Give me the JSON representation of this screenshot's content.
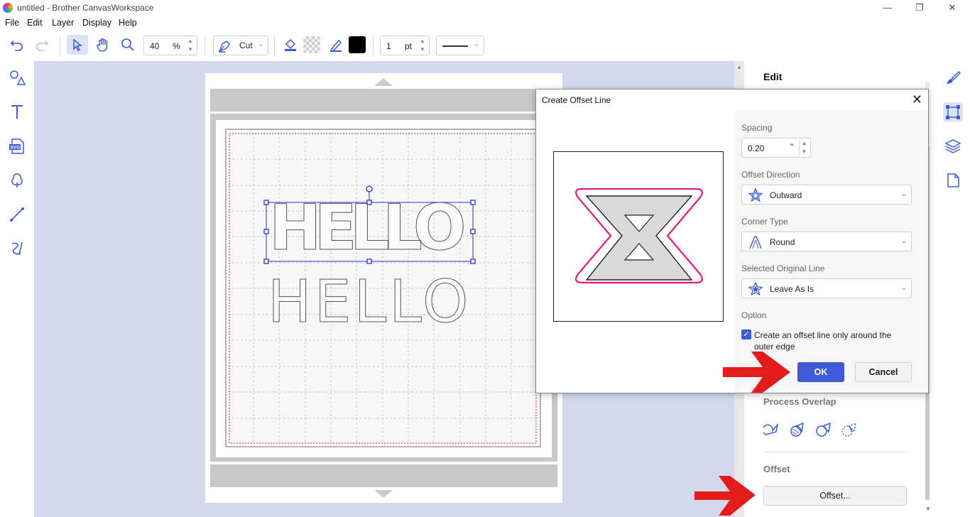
{
  "window": {
    "title": "untitled - Brother CanvasWorkspace"
  },
  "menu": [
    "File",
    "Edit",
    "Layer",
    "Display",
    "Help"
  ],
  "toolbar": {
    "zoom_value": "40",
    "zoom_unit": "%",
    "mode_label": "Cut",
    "line_width_value": "1",
    "line_width_unit": "pt",
    "line_color": "#000000"
  },
  "canvas": {
    "text_top": "HELLO",
    "text_bottom": "HELLO"
  },
  "right_panel": {
    "title": "Edit",
    "process_overlap_label": "Process Overlap",
    "offset_label": "Offset",
    "offset_button": "Offset..."
  },
  "dialog": {
    "title": "Create Offset Line",
    "spacing_label": "Spacing",
    "spacing_value": "0.20",
    "spacing_unit": "\"",
    "offset_direction_label": "Offset Direction",
    "offset_direction_value": "Outward",
    "corner_type_label": "Corner Type",
    "corner_type_value": "Round",
    "selected_original_label": "Selected Original Line",
    "selected_original_value": "Leave As Is",
    "option_label": "Option",
    "checkbox_label_line1": "Create an offset line only around the",
    "checkbox_label_line2": "outer edge",
    "checkbox_checked": true,
    "ok_label": "OK",
    "cancel_label": "Cancel"
  },
  "colors": {
    "accent": "#3d5bd9",
    "canvas_bg": "#d3d8ef",
    "offset_line": "#e0197d",
    "arrow": "#e31b1b"
  }
}
